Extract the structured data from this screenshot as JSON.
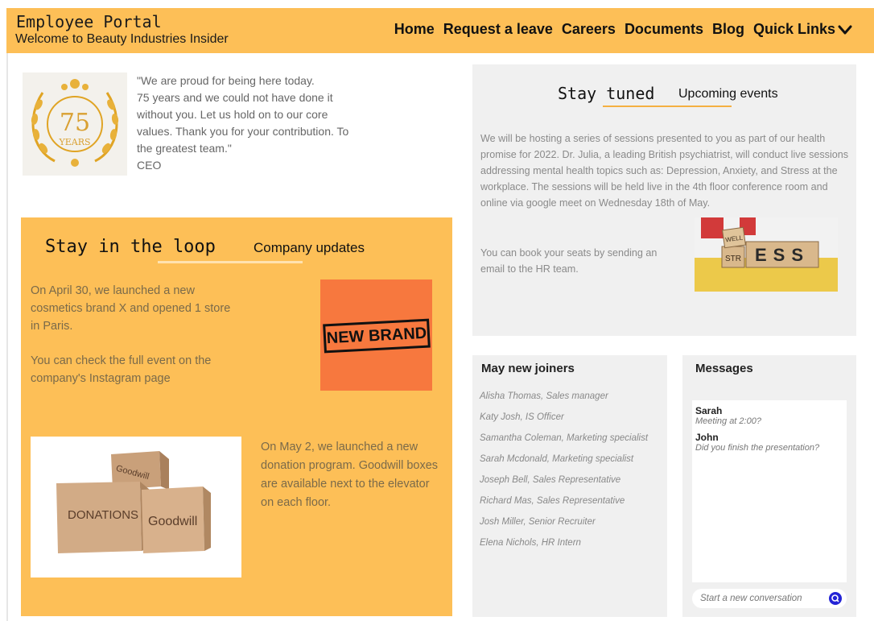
{
  "header": {
    "title": "Employee Portal",
    "subtitle": "Welcome to Beauty Industries Insider",
    "nav": [
      "Home",
      "Request a leave",
      "Careers",
      "Documents",
      "Blog"
    ],
    "quick_links": "Quick Links",
    "quick_links_icon": "chevron-down-icon"
  },
  "ceo": {
    "badge_number": "75",
    "badge_word": "YEARS",
    "quote_lines": [
      "\"We are proud for being here today.",
      "75 years and we could not have done it",
      "without you. Let us hold on to our core",
      "values. Thank you for your contribution. To",
      "the greatest team.\""
    ],
    "author": "CEO"
  },
  "loop": {
    "title": "Stay in the loop",
    "tag": "Company updates",
    "p1": "On April 30, we launched a new cosmetics brand X and opened 1 store in Paris.",
    "p2": "You can check the full event on the company's Instagram page",
    "brand_stamp": "NEW BRAND",
    "p3": "On May 2, we launched a new donation program. Goodwill boxes are available next to the elevator on each floor.",
    "box_labels": [
      "DONATIONS",
      "Goodwill",
      "Goodwill"
    ]
  },
  "tuned": {
    "title": "Stay tuned",
    "tag": "Upcoming events",
    "p1": "We will be hosting a series of sessions presented to you as part of our health promise for 2022. Dr. Julia, a leading British psychiatrist, will conduct live sessions addressing mental health topics such as: Depression, Anxiety, and Stress at the workplace. The sessions will be held live in the 4th floor conference room and online via google meet on Wednesday 18th of May.",
    "p2": "You can book your seats by sending an email to the HR team.",
    "cube_letters": [
      "ESS",
      "STR",
      "WELL"
    ]
  },
  "joiners": {
    "title": "May new joiners",
    "items": [
      "Alisha Thomas, Sales manager",
      "Katy Josh, IS Officer",
      "Samantha Coleman, Marketing specialist",
      "Sarah Mcdonald, Marketing specialist",
      "Joseph Bell, Sales Representative",
      "Richard Mas, Sales Representative",
      "Josh Miller, Senior Recruiter",
      "Elena Nichols, HR Intern"
    ]
  },
  "messages": {
    "title": "Messages",
    "items": [
      {
        "name": "Sarah",
        "text": "Meeting at 2:00?"
      },
      {
        "name": "John",
        "text": "Did you finish the presentation?"
      }
    ],
    "input_placeholder": "Start a new conversation"
  },
  "colors": {
    "accent": "#fdbf57",
    "panel": "#f0f0f0",
    "send": "#2323d6",
    "brand_orange": "#f7783e"
  }
}
